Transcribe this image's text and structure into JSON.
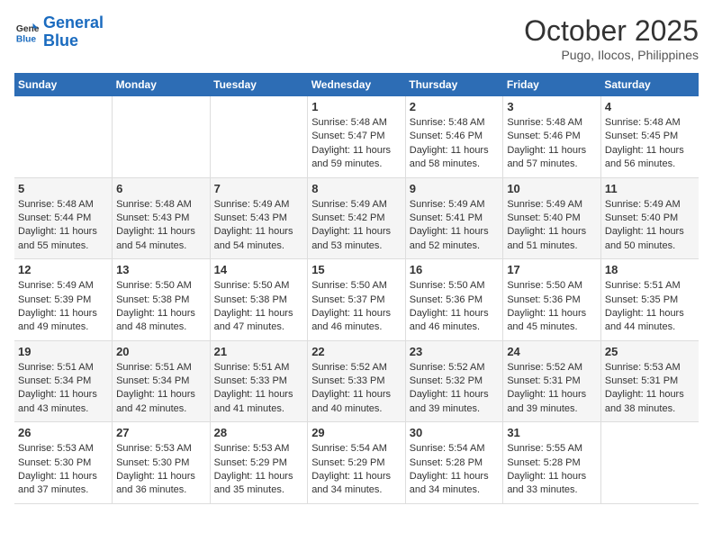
{
  "header": {
    "logo_general": "General",
    "logo_blue": "Blue",
    "month_title": "October 2025",
    "location": "Pugo, Ilocos, Philippines"
  },
  "weekdays": [
    "Sunday",
    "Monday",
    "Tuesday",
    "Wednesday",
    "Thursday",
    "Friday",
    "Saturday"
  ],
  "weeks": [
    [
      {
        "day": "",
        "sunrise": "",
        "sunset": "",
        "daylight": ""
      },
      {
        "day": "",
        "sunrise": "",
        "sunset": "",
        "daylight": ""
      },
      {
        "day": "",
        "sunrise": "",
        "sunset": "",
        "daylight": ""
      },
      {
        "day": "1",
        "sunrise": "Sunrise: 5:48 AM",
        "sunset": "Sunset: 5:47 PM",
        "daylight": "Daylight: 11 hours and 59 minutes."
      },
      {
        "day": "2",
        "sunrise": "Sunrise: 5:48 AM",
        "sunset": "Sunset: 5:46 PM",
        "daylight": "Daylight: 11 hours and 58 minutes."
      },
      {
        "day": "3",
        "sunrise": "Sunrise: 5:48 AM",
        "sunset": "Sunset: 5:46 PM",
        "daylight": "Daylight: 11 hours and 57 minutes."
      },
      {
        "day": "4",
        "sunrise": "Sunrise: 5:48 AM",
        "sunset": "Sunset: 5:45 PM",
        "daylight": "Daylight: 11 hours and 56 minutes."
      }
    ],
    [
      {
        "day": "5",
        "sunrise": "Sunrise: 5:48 AM",
        "sunset": "Sunset: 5:44 PM",
        "daylight": "Daylight: 11 hours and 55 minutes."
      },
      {
        "day": "6",
        "sunrise": "Sunrise: 5:48 AM",
        "sunset": "Sunset: 5:43 PM",
        "daylight": "Daylight: 11 hours and 54 minutes."
      },
      {
        "day": "7",
        "sunrise": "Sunrise: 5:49 AM",
        "sunset": "Sunset: 5:43 PM",
        "daylight": "Daylight: 11 hours and 54 minutes."
      },
      {
        "day": "8",
        "sunrise": "Sunrise: 5:49 AM",
        "sunset": "Sunset: 5:42 PM",
        "daylight": "Daylight: 11 hours and 53 minutes."
      },
      {
        "day": "9",
        "sunrise": "Sunrise: 5:49 AM",
        "sunset": "Sunset: 5:41 PM",
        "daylight": "Daylight: 11 hours and 52 minutes."
      },
      {
        "day": "10",
        "sunrise": "Sunrise: 5:49 AM",
        "sunset": "Sunset: 5:40 PM",
        "daylight": "Daylight: 11 hours and 51 minutes."
      },
      {
        "day": "11",
        "sunrise": "Sunrise: 5:49 AM",
        "sunset": "Sunset: 5:40 PM",
        "daylight": "Daylight: 11 hours and 50 minutes."
      }
    ],
    [
      {
        "day": "12",
        "sunrise": "Sunrise: 5:49 AM",
        "sunset": "Sunset: 5:39 PM",
        "daylight": "Daylight: 11 hours and 49 minutes."
      },
      {
        "day": "13",
        "sunrise": "Sunrise: 5:50 AM",
        "sunset": "Sunset: 5:38 PM",
        "daylight": "Daylight: 11 hours and 48 minutes."
      },
      {
        "day": "14",
        "sunrise": "Sunrise: 5:50 AM",
        "sunset": "Sunset: 5:38 PM",
        "daylight": "Daylight: 11 hours and 47 minutes."
      },
      {
        "day": "15",
        "sunrise": "Sunrise: 5:50 AM",
        "sunset": "Sunset: 5:37 PM",
        "daylight": "Daylight: 11 hours and 46 minutes."
      },
      {
        "day": "16",
        "sunrise": "Sunrise: 5:50 AM",
        "sunset": "Sunset: 5:36 PM",
        "daylight": "Daylight: 11 hours and 46 minutes."
      },
      {
        "day": "17",
        "sunrise": "Sunrise: 5:50 AM",
        "sunset": "Sunset: 5:36 PM",
        "daylight": "Daylight: 11 hours and 45 minutes."
      },
      {
        "day": "18",
        "sunrise": "Sunrise: 5:51 AM",
        "sunset": "Sunset: 5:35 PM",
        "daylight": "Daylight: 11 hours and 44 minutes."
      }
    ],
    [
      {
        "day": "19",
        "sunrise": "Sunrise: 5:51 AM",
        "sunset": "Sunset: 5:34 PM",
        "daylight": "Daylight: 11 hours and 43 minutes."
      },
      {
        "day": "20",
        "sunrise": "Sunrise: 5:51 AM",
        "sunset": "Sunset: 5:34 PM",
        "daylight": "Daylight: 11 hours and 42 minutes."
      },
      {
        "day": "21",
        "sunrise": "Sunrise: 5:51 AM",
        "sunset": "Sunset: 5:33 PM",
        "daylight": "Daylight: 11 hours and 41 minutes."
      },
      {
        "day": "22",
        "sunrise": "Sunrise: 5:52 AM",
        "sunset": "Sunset: 5:33 PM",
        "daylight": "Daylight: 11 hours and 40 minutes."
      },
      {
        "day": "23",
        "sunrise": "Sunrise: 5:52 AM",
        "sunset": "Sunset: 5:32 PM",
        "daylight": "Daylight: 11 hours and 39 minutes."
      },
      {
        "day": "24",
        "sunrise": "Sunrise: 5:52 AM",
        "sunset": "Sunset: 5:31 PM",
        "daylight": "Daylight: 11 hours and 39 minutes."
      },
      {
        "day": "25",
        "sunrise": "Sunrise: 5:53 AM",
        "sunset": "Sunset: 5:31 PM",
        "daylight": "Daylight: 11 hours and 38 minutes."
      }
    ],
    [
      {
        "day": "26",
        "sunrise": "Sunrise: 5:53 AM",
        "sunset": "Sunset: 5:30 PM",
        "daylight": "Daylight: 11 hours and 37 minutes."
      },
      {
        "day": "27",
        "sunrise": "Sunrise: 5:53 AM",
        "sunset": "Sunset: 5:30 PM",
        "daylight": "Daylight: 11 hours and 36 minutes."
      },
      {
        "day": "28",
        "sunrise": "Sunrise: 5:53 AM",
        "sunset": "Sunset: 5:29 PM",
        "daylight": "Daylight: 11 hours and 35 minutes."
      },
      {
        "day": "29",
        "sunrise": "Sunrise: 5:54 AM",
        "sunset": "Sunset: 5:29 PM",
        "daylight": "Daylight: 11 hours and 34 minutes."
      },
      {
        "day": "30",
        "sunrise": "Sunrise: 5:54 AM",
        "sunset": "Sunset: 5:28 PM",
        "daylight": "Daylight: 11 hours and 34 minutes."
      },
      {
        "day": "31",
        "sunrise": "Sunrise: 5:55 AM",
        "sunset": "Sunset: 5:28 PM",
        "daylight": "Daylight: 11 hours and 33 minutes."
      },
      {
        "day": "",
        "sunrise": "",
        "sunset": "",
        "daylight": ""
      }
    ]
  ]
}
